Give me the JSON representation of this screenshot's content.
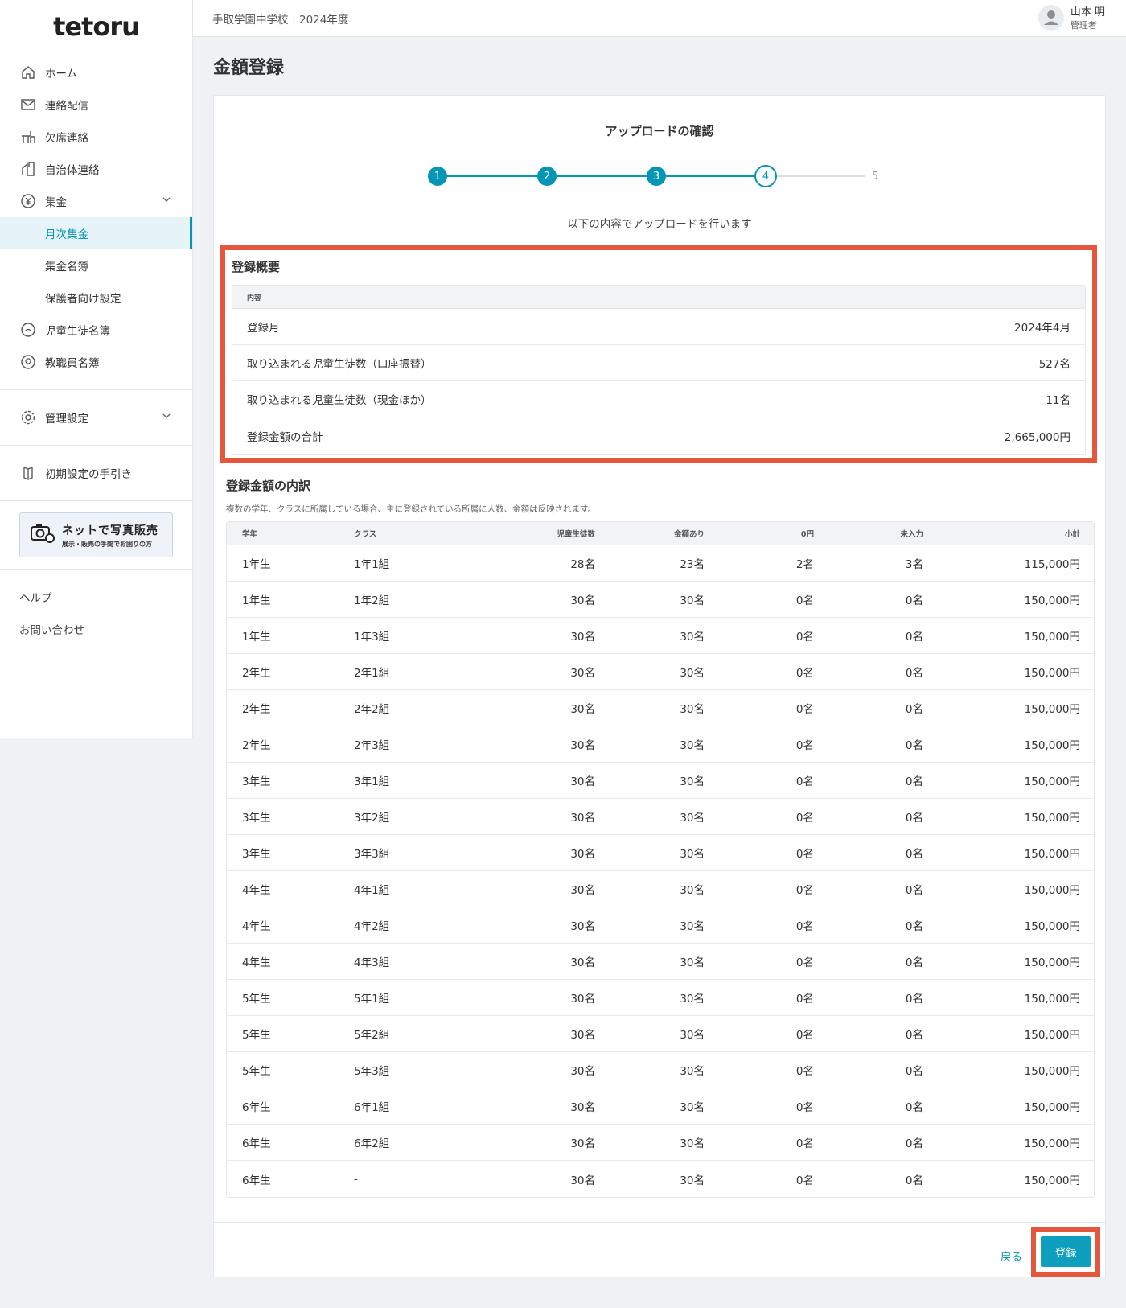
{
  "app": {
    "logo_text": "tetoru",
    "logo_dot_colors": [
      "#e4573d",
      "#5cb85c",
      "#f0ad1e"
    ]
  },
  "sidebar": {
    "items": [
      {
        "label": "ホーム",
        "icon": "home-icon"
      },
      {
        "label": "連絡配信",
        "icon": "mail-icon"
      },
      {
        "label": "欠席連絡",
        "icon": "desk-icon"
      },
      {
        "label": "自治体連絡",
        "icon": "building-icon"
      },
      {
        "label": "集金",
        "icon": "yen-icon"
      }
    ],
    "sub_items": [
      "月次集金",
      "集金名簿",
      "保護者向け設定"
    ],
    "items2": [
      {
        "label": "児童生徒名簿",
        "icon": "students-icon"
      },
      {
        "label": "教職員名簿",
        "icon": "teachers-icon"
      }
    ],
    "admin_label": "管理設定",
    "guide_label": "初期設定の手引き",
    "promo_main": "ネットで写真販売",
    "promo_sub": "展示・販売の手間でお困りの方",
    "help_label": "ヘルプ",
    "contact_label": "お問い合わせ"
  },
  "header": {
    "school": "手取学園中学校｜2024年度",
    "user_name": "山本 明",
    "user_role": "管理者"
  },
  "page": {
    "title": "金額登録"
  },
  "stepper": {
    "title": "アップロードの確認",
    "steps": [
      "1",
      "2",
      "3",
      "4",
      "5"
    ],
    "current_step": 4,
    "description": "以下の内容でアップロードを行います"
  },
  "summary": {
    "title": "登録概要",
    "header": "内容",
    "rows": [
      {
        "label": "登録月",
        "value": "2024年4月"
      },
      {
        "label": "取り込まれる児童生徒数（口座振替）",
        "value": "527名"
      },
      {
        "label": "取り込まれる児童生徒数（現金ほか）",
        "value": "11名"
      },
      {
        "label": "登録金額の合計",
        "value": "2,665,000円"
      }
    ]
  },
  "breakdown": {
    "title": "登録金額の内訳",
    "note": "複数の学年、クラスに所属している場合、主に登録されている所属に人数、金額は反映されます。",
    "headers": [
      "学年",
      "クラス",
      "児童生徒数",
      "金額あり",
      "0円",
      "未入力",
      "小計"
    ],
    "rows": [
      [
        "1年生",
        "1年1組",
        "28名",
        "23名",
        "2名",
        "3名",
        "115,000円"
      ],
      [
        "1年生",
        "1年2組",
        "30名",
        "30名",
        "0名",
        "0名",
        "150,000円"
      ],
      [
        "1年生",
        "1年3組",
        "30名",
        "30名",
        "0名",
        "0名",
        "150,000円"
      ],
      [
        "2年生",
        "2年1組",
        "30名",
        "30名",
        "0名",
        "0名",
        "150,000円"
      ],
      [
        "2年生",
        "2年2組",
        "30名",
        "30名",
        "0名",
        "0名",
        "150,000円"
      ],
      [
        "2年生",
        "2年3組",
        "30名",
        "30名",
        "0名",
        "0名",
        "150,000円"
      ],
      [
        "3年生",
        "3年1組",
        "30名",
        "30名",
        "0名",
        "0名",
        "150,000円"
      ],
      [
        "3年生",
        "3年2組",
        "30名",
        "30名",
        "0名",
        "0名",
        "150,000円"
      ],
      [
        "3年生",
        "3年3組",
        "30名",
        "30名",
        "0名",
        "0名",
        "150,000円"
      ],
      [
        "4年生",
        "4年1組",
        "30名",
        "30名",
        "0名",
        "0名",
        "150,000円"
      ],
      [
        "4年生",
        "4年2組",
        "30名",
        "30名",
        "0名",
        "0名",
        "150,000円"
      ],
      [
        "4年生",
        "4年3組",
        "30名",
        "30名",
        "0名",
        "0名",
        "150,000円"
      ],
      [
        "5年生",
        "5年1組",
        "30名",
        "30名",
        "0名",
        "0名",
        "150,000円"
      ],
      [
        "5年生",
        "5年2組",
        "30名",
        "30名",
        "0名",
        "0名",
        "150,000円"
      ],
      [
        "5年生",
        "5年3組",
        "30名",
        "30名",
        "0名",
        "0名",
        "150,000円"
      ],
      [
        "6年生",
        "6年1組",
        "30名",
        "30名",
        "0名",
        "0名",
        "150,000円"
      ],
      [
        "6年生",
        "6年2組",
        "30名",
        "30名",
        "0名",
        "0名",
        "150,000円"
      ],
      [
        "6年生",
        "-",
        "30名",
        "30名",
        "0名",
        "0名",
        "150,000円"
      ]
    ]
  },
  "actions": {
    "back_label": "戻る",
    "submit_label": "登録"
  },
  "colors": {
    "accent": "#0596b6",
    "highlight": "#e4573d"
  }
}
